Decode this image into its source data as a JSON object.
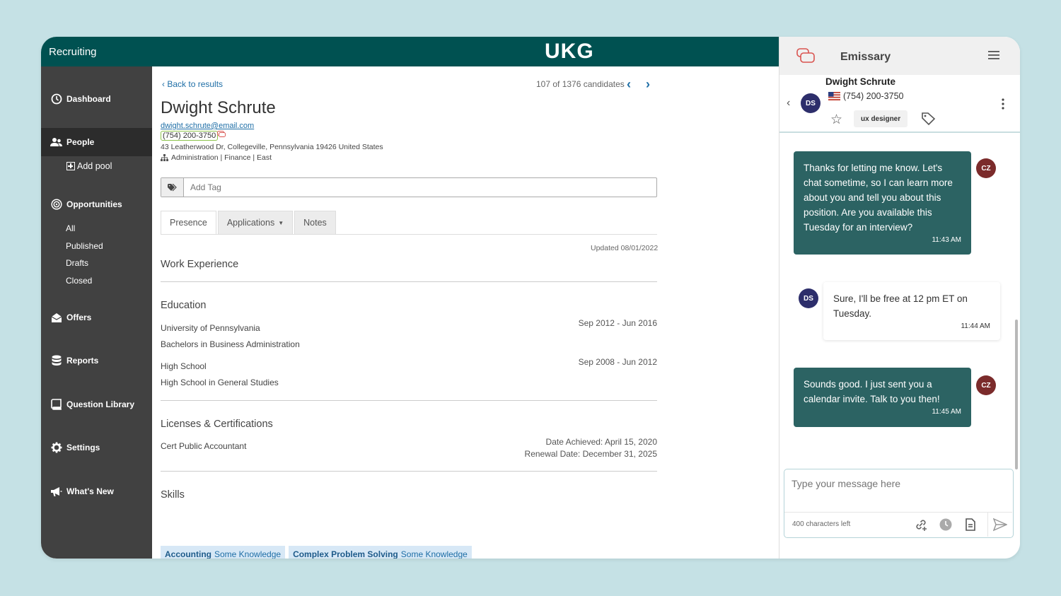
{
  "app": {
    "title": "Recruiting",
    "logo": "UKG"
  },
  "sidebar": {
    "items": [
      {
        "label": "Dashboard",
        "icon": "clock-icon"
      },
      {
        "label": "People",
        "icon": "people-icon",
        "active": true
      },
      {
        "label": "Add pool",
        "icon": "plus-box-icon"
      },
      {
        "label": "Opportunities",
        "icon": "target-icon"
      },
      {
        "label": "All"
      },
      {
        "label": "Published"
      },
      {
        "label": "Drafts"
      },
      {
        "label": "Closed"
      },
      {
        "label": "Offers",
        "icon": "offers-icon"
      },
      {
        "label": "Reports",
        "icon": "database-icon"
      },
      {
        "label": "Question Library",
        "icon": "book-icon"
      },
      {
        "label": "Settings",
        "icon": "gear-icon"
      },
      {
        "label": "What's New",
        "icon": "megaphone-icon"
      }
    ]
  },
  "profile": {
    "back_label": "Back to results",
    "count": "107 of 1376 candidates",
    "name": "Dwight Schrute",
    "email": "dwight.schrute@email.com",
    "phone": "(754) 200-3750",
    "address": "43 Leatherwood Dr, Collegeville, Pennsylvania 19426 United States",
    "department": "Administration | Finance | East",
    "tag_placeholder": "Add Tag",
    "tabs": [
      "Presence",
      "Applications",
      "Notes"
    ],
    "updated": "Updated 08/01/2022",
    "work_heading": "Work Experience",
    "education_heading": "Education",
    "education": [
      {
        "school": "University of Pennsylvania",
        "degree": "Bachelors in Business Administration",
        "dates": "Sep 2012 - Jun 2016"
      },
      {
        "school": "High School",
        "degree": "High School in General Studies",
        "dates": "Sep 2008 - Jun 2012"
      }
    ],
    "licenses_heading": "Licenses & Certifications",
    "license": {
      "name": "Cert Public Accountant",
      "achieved": "Date Achieved: April 15, 2020",
      "renewal": "Renewal Date: December 31, 2025"
    },
    "skills_heading": "Skills",
    "skills": [
      {
        "name": "Accounting",
        "level": "Some Knowledge"
      },
      {
        "name": "Complex Problem Solving",
        "level": "Some Knowledge"
      }
    ]
  },
  "panel": {
    "title": "Emissary",
    "contact_name": "Dwight Schrute",
    "contact_phone": "(754) 200-3750",
    "contact_initials": "DS",
    "chip": "ux designer",
    "agent_initials": "CZ",
    "messages": [
      {
        "dir": "out",
        "text": "Thanks for letting me know. Let's chat sometime, so I can learn more about you and tell you about this position. Are you available this Tuesday for an interview?",
        "time": "11:43 AM"
      },
      {
        "dir": "in",
        "text": "Sure, I'll be free at 12 pm ET on Tuesday.",
        "time": "11:44 AM"
      },
      {
        "dir": "out",
        "text": "Sounds good. I just sent you a calendar invite. Talk to you then!",
        "time": "11:45 AM"
      }
    ],
    "composer_placeholder": "Type your message here",
    "chars_left": "400 characters left"
  },
  "colors": {
    "brand": "#005151",
    "sidebar": "#414141",
    "bubble_out": "#2c6363",
    "link": "#1e6ea6",
    "skill_bg": "#d7e8f6"
  }
}
